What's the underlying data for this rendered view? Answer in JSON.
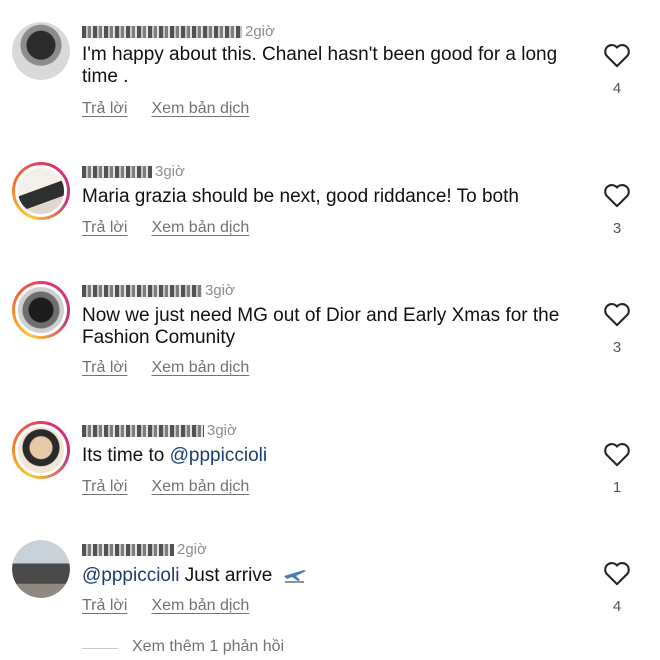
{
  "comments": [
    {
      "username": "teddy.the.barnsdale",
      "time": "2giờ",
      "text": "I'm happy about this. Chanel hasn't been good for a long time .",
      "reply": "Trả lời",
      "translate": "Xem bản dịch",
      "likes": "4",
      "avatar_colors": [
        "#2b2b2b",
        "#d9d9d9"
      ]
    },
    {
      "username": "lisfilanre",
      "time": "3giờ",
      "text": "Maria grazia should be next, good riddance! To both",
      "reply": "Trả lời",
      "translate": "Xem bản dịch",
      "likes": "3",
      "avatar_colors": [
        "#e9e3dc",
        "#3a3a3a"
      ]
    },
    {
      "username": "marilngarcia38",
      "time": "3giờ",
      "text": "Now we just need MG out of Dior and Early Xmas for the Fashion Comunity",
      "reply": "Trả lời",
      "translate": "Xem bản dịch",
      "likes": "3",
      "avatar_colors": [
        "#1d1d1d",
        "#bdbdbd"
      ]
    },
    {
      "username": "_fmirhtyvelurer",
      "time": "3giờ",
      "text_prefix": "Its time to ",
      "mention": "@pppiccioli",
      "reply": "Trả lời",
      "translate": "Xem bản dịch",
      "likes": "1",
      "avatar_colors": [
        "#e7c9a6",
        "#2a2a2a"
      ]
    },
    {
      "username": "ssranngarcia",
      "time": "2giờ",
      "mention": "@pppiccioli",
      "text_suffix": " Just arrive",
      "emoji": "airplane-emoji",
      "reply": "Trả lời",
      "translate": "Xem bản dịch",
      "likes": "4",
      "avatar_colors": [
        "#c9d2d8",
        "#4a4a4a"
      ]
    }
  ],
  "view_more": "Xem thêm 1 phản hồi",
  "colors": {
    "mention": "#1c3d6e",
    "secondary": "#737373",
    "timestamp": "#8e8e8e"
  }
}
